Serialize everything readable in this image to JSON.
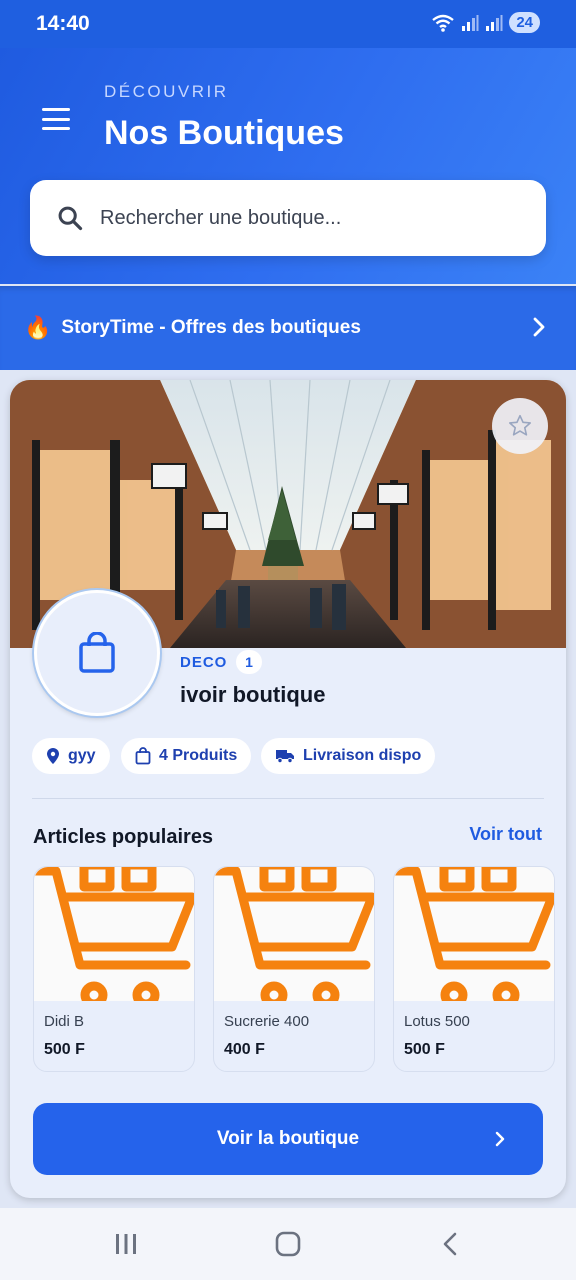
{
  "status_bar": {
    "time": "14:40",
    "battery": "24"
  },
  "header": {
    "eyebrow": "DÉCOUVRIR",
    "title": "Nos Boutiques",
    "search_placeholder": "Rechercher une boutique..."
  },
  "story": {
    "icon": "🔥",
    "label": "StoryTime - Offres des boutiques"
  },
  "shop": {
    "category": "DECO",
    "category_count": "1",
    "name": "ivoir boutique",
    "chips": {
      "location": "gyy",
      "products": "4 Produits",
      "delivery": "Livraison dispo"
    }
  },
  "popular": {
    "title": "Articles populaires",
    "see_all": "Voir tout",
    "items": [
      {
        "name": "Didi B",
        "price": "500 F"
      },
      {
        "name": "Sucrerie 400",
        "price": "400 F"
      },
      {
        "name": "Lotus 500",
        "price": "500 F"
      }
    ]
  },
  "cta": {
    "label": "Voir la boutique"
  },
  "colors": {
    "primary": "#2563eb",
    "header": "#1f5be0",
    "cart_orange": "#f5820f"
  },
  "icons": [
    "menu-icon",
    "search-icon",
    "fire-icon",
    "chevron-right-icon",
    "star-icon",
    "shopping-bag-icon",
    "location-pin-icon",
    "truck-icon",
    "shopping-cart-icon",
    "nav-recents-icon",
    "nav-home-icon",
    "nav-back-icon"
  ]
}
